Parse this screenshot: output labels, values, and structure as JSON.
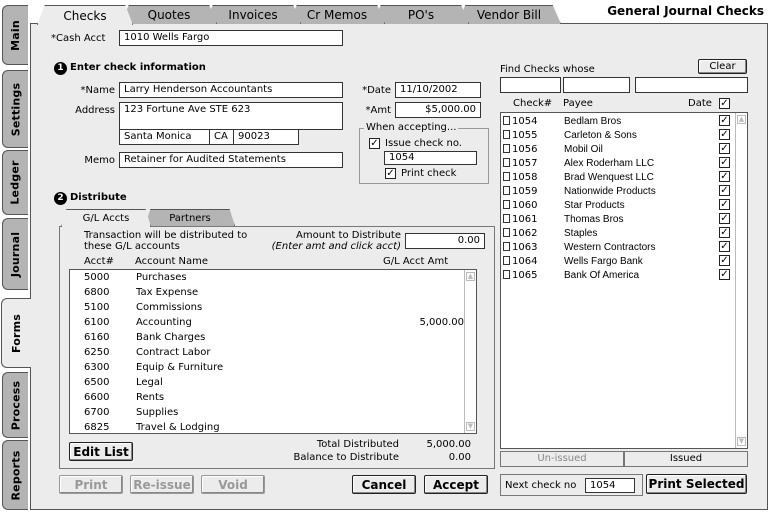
{
  "window_title": "General Journal Checks",
  "side_tabs": [
    {
      "label": "Main"
    },
    {
      "label": "Settings"
    },
    {
      "label": "Ledger"
    },
    {
      "label": "Journal"
    },
    {
      "label": "Forms"
    },
    {
      "label": "Process"
    },
    {
      "label": "Reports"
    }
  ],
  "top_tabs": [
    {
      "label": "Checks"
    },
    {
      "label": "Quotes"
    },
    {
      "label": "Invoices"
    },
    {
      "label": "Cr Memos"
    },
    {
      "label": "PO's"
    },
    {
      "label": "Vendor Bill"
    }
  ],
  "cash_acct": {
    "label": "*Cash Acct",
    "value": "1010 Wells Fargo"
  },
  "section1": {
    "num": "1",
    "title": "Enter check information",
    "name_label": "*Name",
    "name_value": "Larry Henderson Accountants",
    "address_label": "Address",
    "address_line1": "123 Fortune Ave STE 623",
    "city": "Santa Monica",
    "state": "CA",
    "zip": "90023",
    "memo_label": "Memo",
    "memo_value": "Retainer for Audited Statements",
    "date_label": "*Date",
    "date_value": "11/10/2002",
    "amt_label": "*Amt",
    "amt_value": "$5,000.00",
    "accepting_label": "When accepting...",
    "issue_check_label": "Issue check no.",
    "issue_check_value": "1054",
    "print_check_label": "Print check",
    "check_mark": "✓"
  },
  "section2": {
    "num": "2",
    "title": "Distribute",
    "tabs": [
      {
        "label": "G/L Accts"
      },
      {
        "label": "Partners"
      }
    ],
    "desc_line1": "Transaction will be distributed to",
    "desc_line2": "these G/L accounts",
    "amt_dist_label": "Amount to Distribute",
    "amt_dist_hint": "(Enter amt and click acct)",
    "amt_dist_value": "0.00",
    "columns": {
      "acct": "Acct#",
      "name": "Account Name",
      "amt": "G/L Acct Amt"
    },
    "accounts": [
      {
        "acct": "5000",
        "name": "Purchases",
        "amt": ""
      },
      {
        "acct": "6800",
        "name": "Tax Expense",
        "amt": ""
      },
      {
        "acct": "5100",
        "name": "Commissions",
        "amt": ""
      },
      {
        "acct": "6100",
        "name": "Accounting",
        "amt": "5,000.00"
      },
      {
        "acct": "6160",
        "name": "Bank Charges",
        "amt": ""
      },
      {
        "acct": "6250",
        "name": "Contract Labor",
        "amt": ""
      },
      {
        "acct": "6300",
        "name": "Equip & Furniture",
        "amt": ""
      },
      {
        "acct": "6500",
        "name": "Legal",
        "amt": ""
      },
      {
        "acct": "6600",
        "name": "Rents",
        "amt": ""
      },
      {
        "acct": "6700",
        "name": "Supplies",
        "amt": ""
      },
      {
        "acct": "6825",
        "name": "Travel & Lodging",
        "amt": ""
      }
    ],
    "edit_list_label": "Edit List",
    "total_distributed_label": "Total Distributed",
    "total_distributed_value": "5,000.00",
    "balance_label": "Balance to Distribute",
    "balance_value": "0.00"
  },
  "find": {
    "label": "Find Checks whose",
    "clear_label": "Clear",
    "columns": {
      "check": "Check#",
      "payee": "Payee",
      "date": "Date"
    },
    "checks": [
      {
        "num": "1054",
        "payee": "Bedlam Bros"
      },
      {
        "num": "1055",
        "payee": "Carleton & Sons"
      },
      {
        "num": "1056",
        "payee": "Mobil Oil"
      },
      {
        "num": "1057",
        "payee": "Alex Roderham LLC"
      },
      {
        "num": "1058",
        "payee": "Brad Wenquest LLC"
      },
      {
        "num": "1059",
        "payee": "Nationwide Products"
      },
      {
        "num": "1060",
        "payee": "Star Products"
      },
      {
        "num": "1061",
        "payee": "Thomas Bros"
      },
      {
        "num": "1062",
        "payee": "Staples"
      },
      {
        "num": "1063",
        "payee": "Western Contractors"
      },
      {
        "num": "1064",
        "payee": "Wells Fargo Bank"
      },
      {
        "num": "1065",
        "payee": "Bank Of America"
      }
    ],
    "unissued_label": "Un-issued",
    "issued_label": "Issued",
    "next_check_label": "Next check no",
    "next_check_value": "1054"
  },
  "buttons": {
    "print": "Print",
    "reissue": "Re-issue",
    "void": "Void",
    "cancel": "Cancel",
    "accept": "Accept",
    "print_selected": "Print Selected"
  },
  "colors": {
    "panel": "#ececec",
    "tab": "#b4b4b4",
    "disabled": "#999999"
  }
}
